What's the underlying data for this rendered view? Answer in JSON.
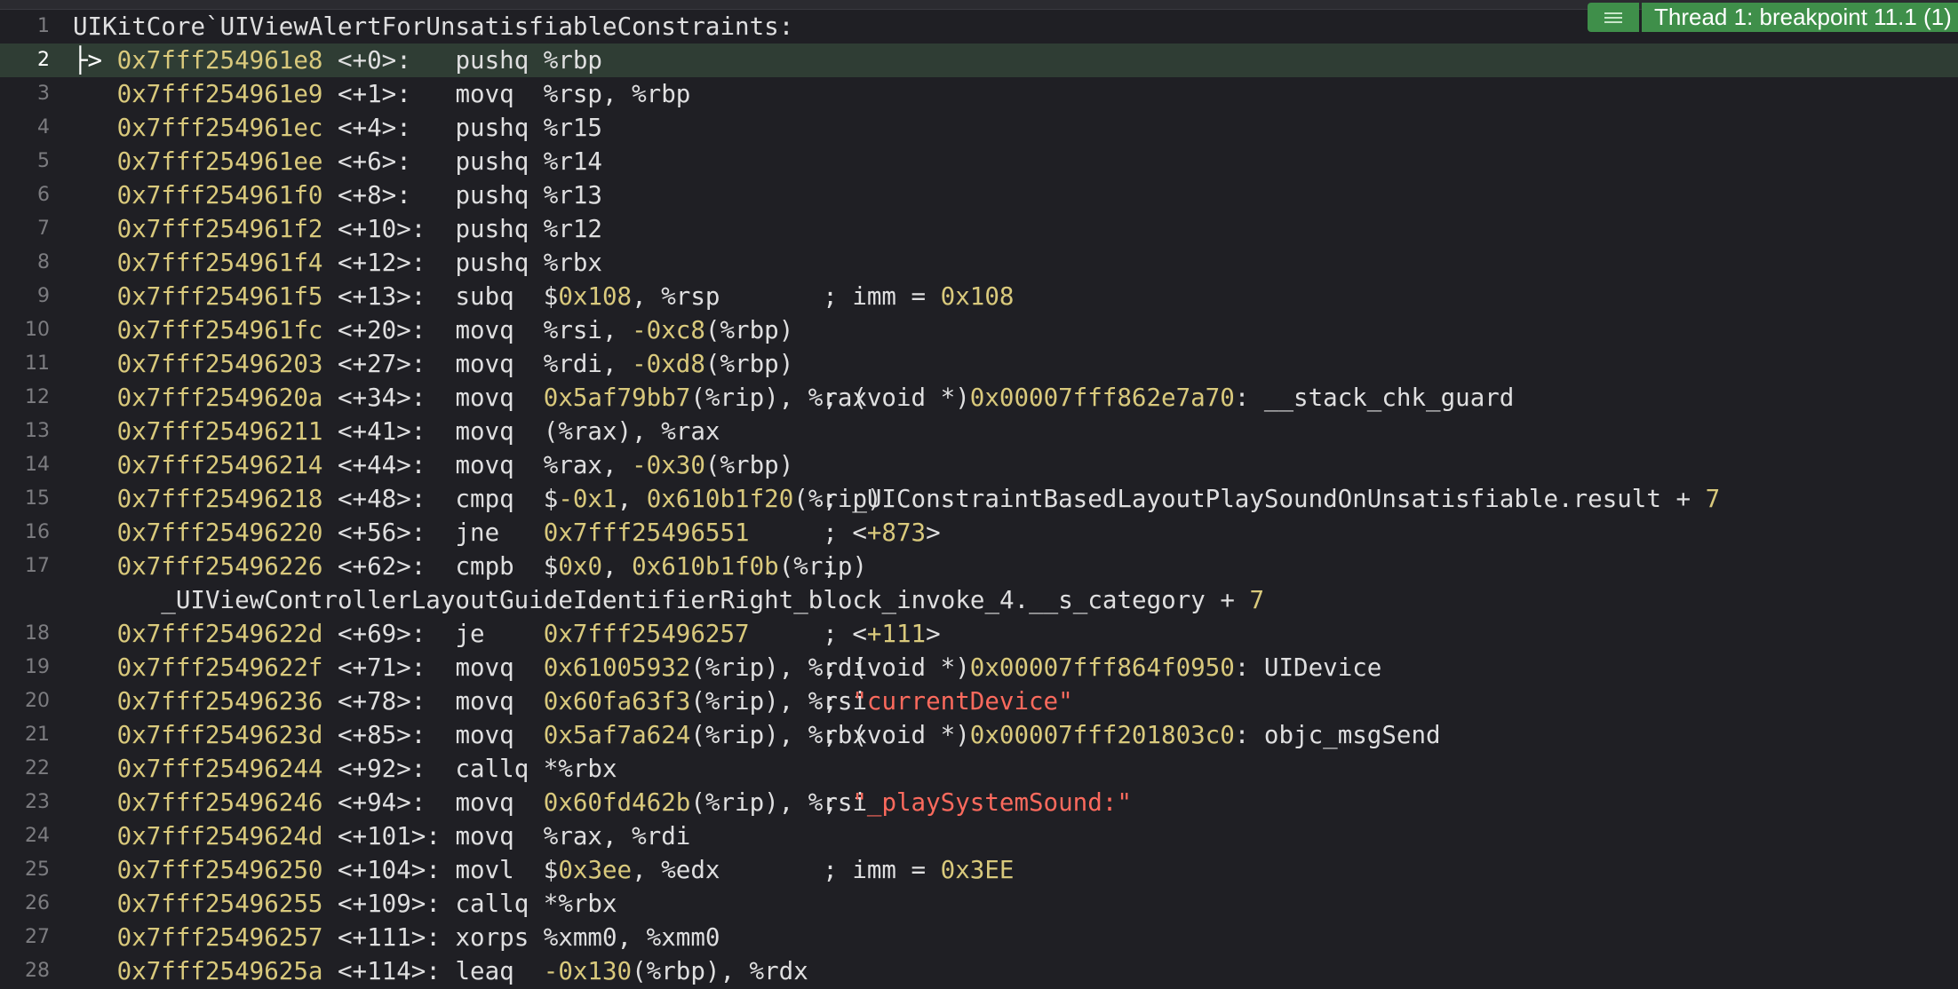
{
  "editor": {
    "lines": [
      {
        "n": "1",
        "header": "UIKitCore`UIViewAlertForUnsatisfiableConstraints:"
      },
      {
        "n": "2",
        "current": true,
        "addr": "0x7fff254961e8",
        "off": "<+0>:",
        "pad": "   ",
        "mnem": "pushq",
        "ops": [
          [
            "plain",
            "%rbp"
          ]
        ],
        "comment": []
      },
      {
        "n": "3",
        "addr": "0x7fff254961e9",
        "off": "<+1>:",
        "pad": "   ",
        "mnem": "movq",
        "ops": [
          [
            "plain",
            "%rsp, %rbp"
          ]
        ],
        "comment": []
      },
      {
        "n": "4",
        "addr": "0x7fff254961ec",
        "off": "<+4>:",
        "pad": "   ",
        "mnem": "pushq",
        "ops": [
          [
            "plain",
            "%r15"
          ]
        ],
        "comment": []
      },
      {
        "n": "5",
        "addr": "0x7fff254961ee",
        "off": "<+6>:",
        "pad": "   ",
        "mnem": "pushq",
        "ops": [
          [
            "plain",
            "%r14"
          ]
        ],
        "comment": []
      },
      {
        "n": "6",
        "addr": "0x7fff254961f0",
        "off": "<+8>:",
        "pad": "   ",
        "mnem": "pushq",
        "ops": [
          [
            "plain",
            "%r13"
          ]
        ],
        "comment": []
      },
      {
        "n": "7",
        "addr": "0x7fff254961f2",
        "off": "<+10>:",
        "pad": "  ",
        "mnem": "pushq",
        "ops": [
          [
            "plain",
            "%r12"
          ]
        ],
        "comment": []
      },
      {
        "n": "8",
        "addr": "0x7fff254961f4",
        "off": "<+12>:",
        "pad": "  ",
        "mnem": "pushq",
        "ops": [
          [
            "plain",
            "%rbx"
          ]
        ],
        "comment": []
      },
      {
        "n": "9",
        "addr": "0x7fff254961f5",
        "off": "<+13>:",
        "pad": "  ",
        "mnem": "subq",
        "ops": [
          [
            "plain",
            "$"
          ],
          [
            "num",
            "0x108"
          ],
          [
            "plain",
            ", %rsp"
          ]
        ],
        "comment": [
          [
            "plain",
            "; imm = "
          ],
          [
            "num",
            "0x108"
          ]
        ]
      },
      {
        "n": "10",
        "addr": "0x7fff254961fc",
        "off": "<+20>:",
        "pad": "  ",
        "mnem": "movq",
        "ops": [
          [
            "plain",
            "%rsi, "
          ],
          [
            "num",
            "-0xc8"
          ],
          [
            "plain",
            "(%rbp)"
          ]
        ],
        "comment": []
      },
      {
        "n": "11",
        "addr": "0x7fff25496203",
        "off": "<+27>:",
        "pad": "  ",
        "mnem": "movq",
        "ops": [
          [
            "plain",
            "%rdi, "
          ],
          [
            "num",
            "-0xd8"
          ],
          [
            "plain",
            "(%rbp)"
          ]
        ],
        "comment": []
      },
      {
        "n": "12",
        "addr": "0x7fff2549620a",
        "off": "<+34>:",
        "pad": "  ",
        "mnem": "movq",
        "ops": [
          [
            "num",
            "0x5af79bb7"
          ],
          [
            "plain",
            "(%rip), %rax"
          ]
        ],
        "comment": [
          [
            "plain",
            "; (void *)"
          ],
          [
            "num",
            "0x00007fff862e7a70"
          ],
          [
            "plain",
            ": __stack_chk_guard"
          ]
        ]
      },
      {
        "n": "13",
        "addr": "0x7fff25496211",
        "off": "<+41>:",
        "pad": "  ",
        "mnem": "movq",
        "ops": [
          [
            "plain",
            "(%rax), %rax"
          ]
        ],
        "comment": []
      },
      {
        "n": "14",
        "addr": "0x7fff25496214",
        "off": "<+44>:",
        "pad": "  ",
        "mnem": "movq",
        "ops": [
          [
            "plain",
            "%rax, "
          ],
          [
            "num",
            "-0x30"
          ],
          [
            "plain",
            "(%rbp)"
          ]
        ],
        "comment": []
      },
      {
        "n": "15",
        "addr": "0x7fff25496218",
        "off": "<+48>:",
        "pad": "  ",
        "mnem": "cmpq",
        "ops": [
          [
            "plain",
            "$"
          ],
          [
            "num",
            "-0x1"
          ],
          [
            "plain",
            ", "
          ],
          [
            "num",
            "0x610b1f20"
          ],
          [
            "plain",
            "(%rip)"
          ]
        ],
        "comment": [
          [
            "plain",
            "; _UIConstraintBasedLayoutPlaySoundOnUnsatisfiable.result + "
          ],
          [
            "num",
            "7"
          ]
        ]
      },
      {
        "n": "16",
        "addr": "0x7fff25496220",
        "off": "<+56>:",
        "pad": "  ",
        "mnem": "jne",
        "ops": [
          [
            "num",
            "0x7fff25496551"
          ]
        ],
        "comment": [
          [
            "plain",
            "; <"
          ],
          [
            "num",
            "+873"
          ],
          [
            "plain",
            ">"
          ]
        ]
      },
      {
        "n": "17",
        "addr": "0x7fff25496226",
        "off": "<+62>:",
        "pad": "  ",
        "mnem": "cmpb",
        "ops": [
          [
            "plain",
            "$"
          ],
          [
            "num",
            "0x0"
          ],
          [
            "plain",
            ", "
          ],
          [
            "num",
            "0x610b1f0b"
          ],
          [
            "plain",
            "(%rip)"
          ]
        ],
        "comment": [
          [
            "plain",
            ";"
          ]
        ]
      },
      {
        "n": "",
        "cont": [
          [
            "plain",
            "_UIViewControllerLayoutGuideIdentifierRight_block_invoke_4.__s_category + "
          ],
          [
            "num",
            "7"
          ]
        ]
      },
      {
        "n": "18",
        "addr": "0x7fff2549622d",
        "off": "<+69>:",
        "pad": "  ",
        "mnem": "je",
        "ops": [
          [
            "num",
            "0x7fff25496257"
          ]
        ],
        "comment": [
          [
            "plain",
            "; <"
          ],
          [
            "num",
            "+111"
          ],
          [
            "plain",
            ">"
          ]
        ]
      },
      {
        "n": "19",
        "addr": "0x7fff2549622f",
        "off": "<+71>:",
        "pad": "  ",
        "mnem": "movq",
        "ops": [
          [
            "num",
            "0x61005932"
          ],
          [
            "plain",
            "(%rip), %rdi"
          ]
        ],
        "comment": [
          [
            "plain",
            "; (void *)"
          ],
          [
            "num",
            "0x00007fff864f0950"
          ],
          [
            "plain",
            ": UIDevice"
          ]
        ]
      },
      {
        "n": "20",
        "addr": "0x7fff25496236",
        "off": "<+78>:",
        "pad": "  ",
        "mnem": "movq",
        "ops": [
          [
            "num",
            "0x60fa63f3"
          ],
          [
            "plain",
            "(%rip), %rsi"
          ]
        ],
        "comment": [
          [
            "plain",
            "; "
          ],
          [
            "str",
            "\"currentDevice\""
          ]
        ]
      },
      {
        "n": "21",
        "addr": "0x7fff2549623d",
        "off": "<+85>:",
        "pad": "  ",
        "mnem": "movq",
        "ops": [
          [
            "num",
            "0x5af7a624"
          ],
          [
            "plain",
            "(%rip), %rbx"
          ]
        ],
        "comment": [
          [
            "plain",
            "; (void *)"
          ],
          [
            "num",
            "0x00007fff201803c0"
          ],
          [
            "plain",
            ": objc_msgSend"
          ]
        ]
      },
      {
        "n": "22",
        "addr": "0x7fff25496244",
        "off": "<+92>:",
        "pad": "  ",
        "mnem": "callq",
        "ops": [
          [
            "plain",
            "*%rbx"
          ]
        ],
        "comment": []
      },
      {
        "n": "23",
        "addr": "0x7fff25496246",
        "off": "<+94>:",
        "pad": "  ",
        "mnem": "movq",
        "ops": [
          [
            "num",
            "0x60fd462b"
          ],
          [
            "plain",
            "(%rip), %rsi"
          ]
        ],
        "comment": [
          [
            "plain",
            "; "
          ],
          [
            "str",
            "\"_playSystemSound:\""
          ]
        ]
      },
      {
        "n": "24",
        "addr": "0x7fff2549624d",
        "off": "<+101>:",
        "pad": " ",
        "mnem": "movq",
        "ops": [
          [
            "plain",
            "%rax, %rdi"
          ]
        ],
        "comment": []
      },
      {
        "n": "25",
        "addr": "0x7fff25496250",
        "off": "<+104>:",
        "pad": " ",
        "mnem": "movl",
        "ops": [
          [
            "plain",
            "$"
          ],
          [
            "num",
            "0x3ee"
          ],
          [
            "plain",
            ", %edx"
          ]
        ],
        "comment": [
          [
            "plain",
            "; imm = "
          ],
          [
            "num",
            "0x3EE"
          ]
        ]
      },
      {
        "n": "26",
        "addr": "0x7fff25496255",
        "off": "<+109>:",
        "pad": " ",
        "mnem": "callq",
        "ops": [
          [
            "plain",
            "*%rbx"
          ]
        ],
        "comment": []
      },
      {
        "n": "27",
        "addr": "0x7fff25496257",
        "off": "<+111>:",
        "pad": " ",
        "mnem": "xorps",
        "ops": [
          [
            "plain",
            "%xmm0, %xmm0"
          ]
        ],
        "comment": []
      },
      {
        "n": "28",
        "addr": "0x7fff2549625a",
        "off": "<+114>:",
        "pad": " ",
        "mnem": "leaq",
        "ops": [
          [
            "num",
            "-0x130"
          ],
          [
            "plain",
            "(%rbp), %rdx"
          ]
        ],
        "comment": []
      }
    ],
    "pc_arrow": "├>"
  },
  "thread_badge": {
    "label": "Thread 1: breakpoint 11.1 (1)",
    "icon": "list-icon"
  },
  "colors": {
    "background": "#1f1f24",
    "current_line": "#2f3d34",
    "address": "#d9c97c",
    "string": "#fc6a5d",
    "badge": "#3f8f4a"
  }
}
